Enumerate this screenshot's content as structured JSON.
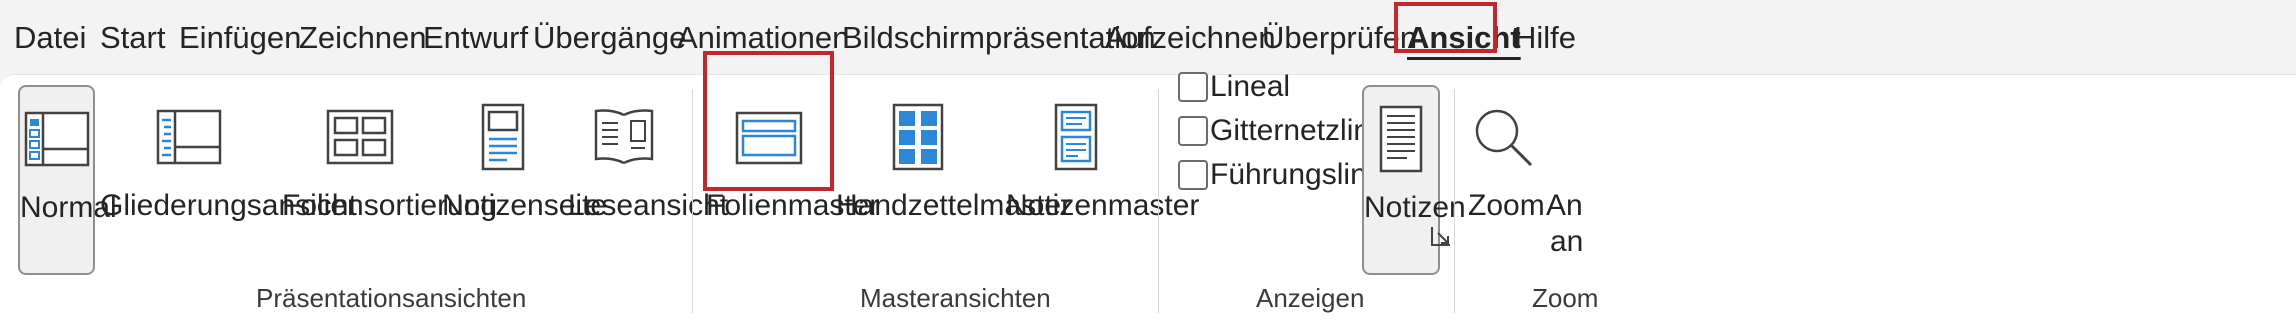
{
  "menu": {
    "tabs": [
      {
        "label": "Datei"
      },
      {
        "label": "Start"
      },
      {
        "label": "Einfügen"
      },
      {
        "label": "Zeichnen"
      },
      {
        "label": "Entwurf"
      },
      {
        "label": "Übergänge"
      },
      {
        "label": "Animationen"
      },
      {
        "label": "Bildschirmpräsentation"
      },
      {
        "label": "Aufzeichnen"
      },
      {
        "label": "Überprüfen"
      },
      {
        "label": "Ansicht"
      },
      {
        "label": "Hilfe"
      }
    ],
    "active_tab": "Ansicht"
  },
  "ribbon": {
    "presentation_views": {
      "group_label": "Präsentationsansichten",
      "normal": "Normal",
      "outline": "Gliederungsansicht",
      "slide_sorter": "Foliensortierung",
      "notes_page": "Notizenseite",
      "reading_view": "Leseansicht"
    },
    "master_views": {
      "group_label": "Masteransichten",
      "slide_master": "Folienmaster",
      "handout_master": "Handzettelmaster",
      "notes_master": "Notizenmaster"
    },
    "show": {
      "group_label": "Anzeigen",
      "ruler": "Lineal",
      "gridlines": "Gitternetzlinien",
      "guides": "Führungslinien",
      "notes": "Notizen"
    },
    "zoom": {
      "group_label": "Zoom",
      "zoom": "Zoom",
      "fit_line1": "An",
      "fit_line2": "an"
    }
  },
  "colors": {
    "accent_blue": "#2b88d8",
    "highlight_red": "#c4262e"
  }
}
